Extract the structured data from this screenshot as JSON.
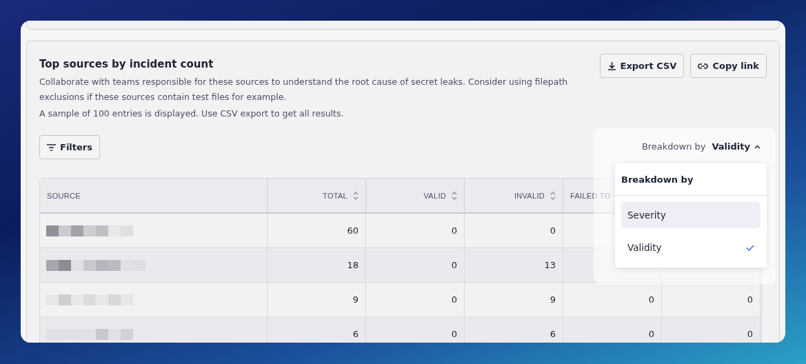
{
  "panel": {
    "title": "Top sources by incident count",
    "description": "Collaborate with teams responsible for these sources to understand the root cause of secret leaks. Consider using filepath exclusions if these sources contain test files for example.",
    "note": "A sample of 100 entries is displayed. Use CSV export to get all results.",
    "actions": [
      "Export CSV",
      "Copy link"
    ],
    "filters_button": "Filters"
  },
  "breakdown": {
    "label": "Breakdown by",
    "value": "Validity",
    "expanded": true,
    "menu": {
      "title": "Breakdown by",
      "options": [
        {
          "label": "Severity",
          "selected": false,
          "highlighted": true
        },
        {
          "label": "Validity",
          "selected": true,
          "highlighted": false
        }
      ]
    }
  },
  "table": {
    "columns": [
      {
        "label": "SOURCE",
        "sortable": false
      },
      {
        "label": "TOTAL",
        "sortable": true
      },
      {
        "label": "VALID",
        "sortable": true
      },
      {
        "label": "INVALID",
        "sortable": true
      },
      {
        "label": "FAILED TO",
        "sortable": false
      }
    ],
    "rows": [
      {
        "source": {
          "kind": "picture"
        },
        "cells": [
          "60",
          "0",
          "0"
        ]
      },
      {
        "source": {
          "kind": "picture"
        },
        "cells": [
          "18",
          "0",
          "13"
        ]
      },
      {
        "source": {
          "kind": "picture"
        },
        "cells": [
          "9",
          "0",
          "9",
          "0",
          "0"
        ]
      },
      {
        "source": {
          "kind": "picture"
        },
        "cells": [
          "6",
          "0",
          "6",
          "0",
          "0"
        ]
      }
    ]
  }
}
